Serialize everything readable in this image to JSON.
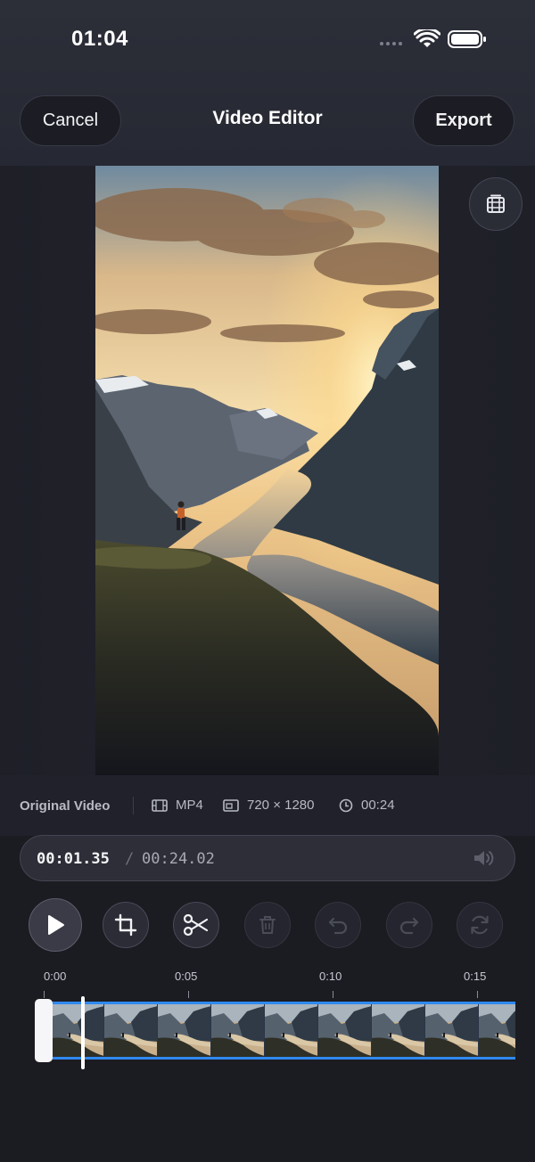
{
  "status_bar": {
    "time": "01:04"
  },
  "nav": {
    "cancel_label": "Cancel",
    "title": "Video Editor",
    "export_label": "Export"
  },
  "video_info": {
    "label": "Original Video",
    "format": "MP4",
    "resolution": "720 × 1280",
    "duration": "00:24"
  },
  "playback": {
    "current_time": "00:01.35",
    "separator": "/",
    "total_time": "00:24.02"
  },
  "toolbar": {
    "tools": [
      {
        "name": "play-button",
        "icon": "play-icon",
        "enabled": true
      },
      {
        "name": "crop-button",
        "icon": "crop-icon",
        "enabled": true
      },
      {
        "name": "cut-button",
        "icon": "scissors-icon",
        "enabled": true
      },
      {
        "name": "delete-button",
        "icon": "trash-icon",
        "enabled": false
      },
      {
        "name": "undo-button",
        "icon": "undo-icon",
        "enabled": false
      },
      {
        "name": "redo-button",
        "icon": "redo-icon",
        "enabled": false
      },
      {
        "name": "reset-button",
        "icon": "refresh-icon",
        "enabled": false
      }
    ]
  },
  "timeline": {
    "ticks": [
      "0:00",
      "0:05",
      "0:10",
      "0:15"
    ],
    "playhead_time": "00:01.35",
    "thumbnail_count": 9
  },
  "colors": {
    "accent": "#2f89f0",
    "background": "#1b1b22"
  }
}
